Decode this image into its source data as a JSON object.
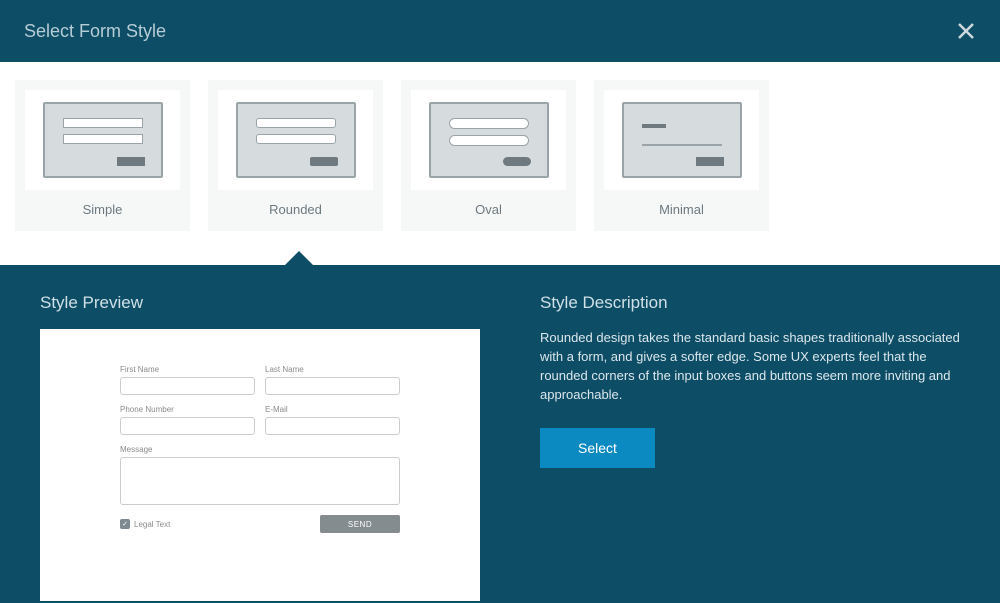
{
  "header": {
    "title": "Select Form Style"
  },
  "styles": [
    {
      "label": "Simple"
    },
    {
      "label": "Rounded"
    },
    {
      "label": "Oval"
    },
    {
      "label": "Minimal"
    }
  ],
  "preview": {
    "title": "Style Preview",
    "form": {
      "first_name": "First Name",
      "last_name": "Last Name",
      "phone": "Phone Number",
      "email": "E-Mail",
      "message": "Message",
      "legal": "Legal Text",
      "send": "SEND"
    }
  },
  "description": {
    "title": "Style Description",
    "body": "Rounded design takes the standard basic shapes traditionally associated with a form, and gives a softer edge. Some UX experts feel that the rounded corners of the input boxes and buttons seem more inviting and approachable.",
    "select_label": "Select"
  }
}
